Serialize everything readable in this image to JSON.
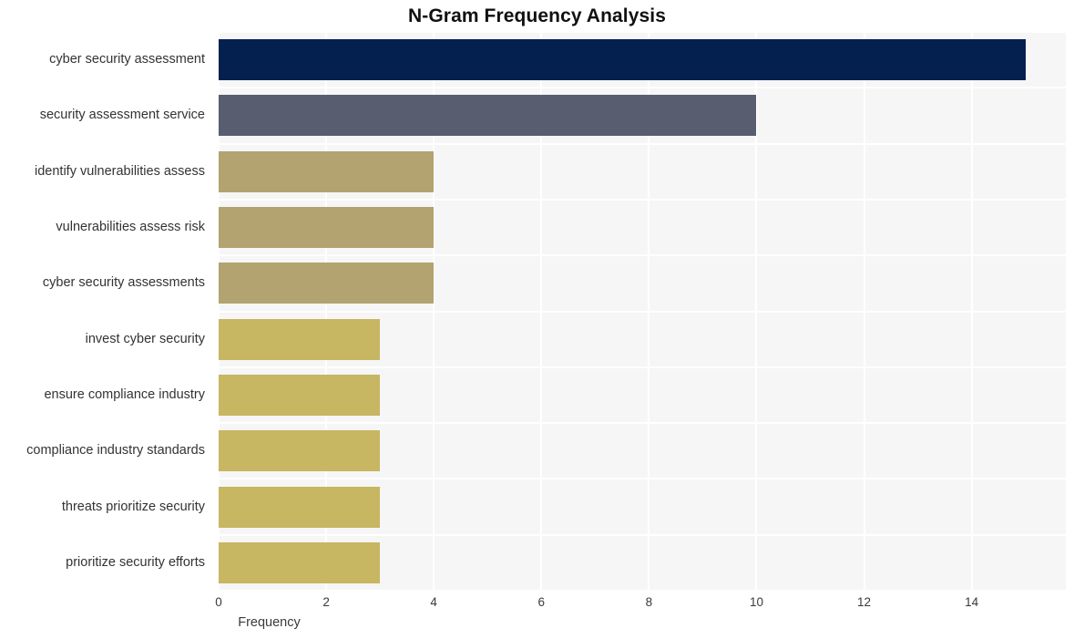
{
  "chart_data": {
    "type": "bar",
    "orientation": "horizontal",
    "title": "N-Gram Frequency Analysis",
    "xlabel": "Frequency",
    "ylabel": "",
    "categories": [
      "cyber security assessment",
      "security assessment service",
      "identify vulnerabilities assess",
      "vulnerabilities assess risk",
      "cyber security assessments",
      "invest cyber security",
      "ensure compliance industry",
      "compliance industry standards",
      "threats prioritize security",
      "prioritize security efforts"
    ],
    "values": [
      15,
      10,
      4,
      4,
      4,
      3,
      3,
      3,
      3,
      3
    ],
    "bar_colors": [
      "#04204f",
      "#585d70",
      "#b2a371",
      "#b2a371",
      "#b2a371",
      "#c7b662",
      "#c7b662",
      "#c7b662",
      "#c7b662",
      "#c7b662"
    ],
    "xlim": [
      0,
      15.75
    ],
    "xticks": [
      0,
      2,
      4,
      6,
      8,
      10,
      12,
      14
    ],
    "xtick_labels": [
      "0",
      "2",
      "4",
      "6",
      "8",
      "10",
      "12",
      "14"
    ],
    "grid": true,
    "grid_color": "#ffffff",
    "plot_background": "#f6f6f7",
    "figure_background": "#ffffff",
    "legend": null,
    "title_color": "#111111",
    "tick_label_color": "#3a3a3a"
  }
}
